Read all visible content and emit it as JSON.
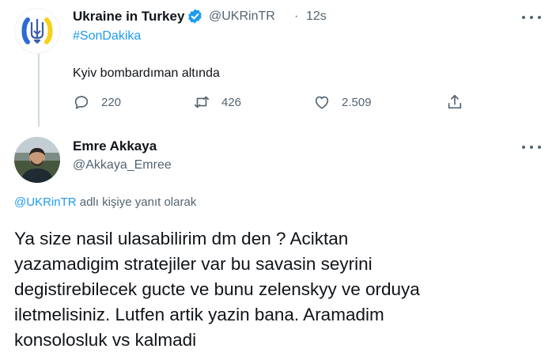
{
  "tweet1": {
    "author_name": "Ukraine in Turkey",
    "handle": "@UKRinTR",
    "separator": "·",
    "time": "12s",
    "hashtag": "#SonDakika",
    "text": "Kyiv bombardıman altında",
    "replies": "220",
    "retweets": "426",
    "likes": "2.509",
    "avatar_icon": "ukraine-trident-icon"
  },
  "tweet2": {
    "author_name": "Emre Akkaya",
    "handle": "@Akkaya_Emree",
    "reply_mention": "@UKRinTR",
    "reply_suffix": " adlı kişiye yanıt olarak",
    "text": "Ya size nasil ulasabilirim dm den ? Aciktan\nyazamadigim stratejiler var bu savasin seyrini\ndegistirebilecek gucte ve bunu zelenskyy ve orduya\niletmelisiniz. Lutfen artik yazin bana.  Aramadim\nkonsolosluk vs kalmadi"
  },
  "colors": {
    "link": "#1d9bf0",
    "muted": "#536471",
    "text": "#0f1419",
    "ukraine_blue": "#2c6bd6",
    "ukraine_yellow": "#f7d117"
  }
}
